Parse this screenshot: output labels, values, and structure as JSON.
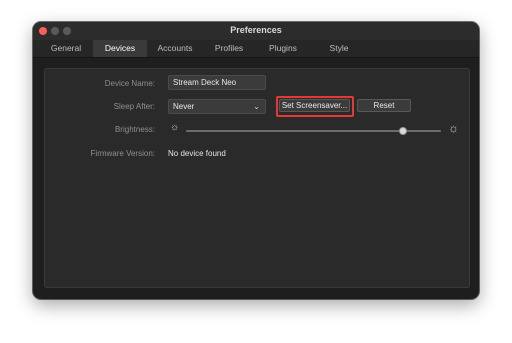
{
  "window": {
    "title": "Preferences"
  },
  "tabs": [
    {
      "label": "General",
      "active": false
    },
    {
      "label": "Devices",
      "active": true
    },
    {
      "label": "Accounts",
      "active": false
    },
    {
      "label": "Profiles",
      "active": false
    },
    {
      "label": "Plugins",
      "active": false
    },
    {
      "label": "Style",
      "active": false
    }
  ],
  "device": {
    "name_label": "Device Name:",
    "name_value": "Stream Deck Neo",
    "sleep_label": "Sleep After:",
    "sleep_value": "Never",
    "set_screensaver_label": "Set Screensaver...",
    "reset_label": "Reset",
    "brightness_label": "Brightness:",
    "brightness_level": 0.85,
    "firmware_label": "Firmware Version:",
    "firmware_value": "No device found"
  },
  "icons": {
    "brightness_low": "sun-dim-icon",
    "brightness_high": "sun-bright-icon",
    "select_arrow": "chevron-down-icon"
  },
  "colors": {
    "highlight": "#e53935",
    "close_button": "#ff5f57"
  }
}
